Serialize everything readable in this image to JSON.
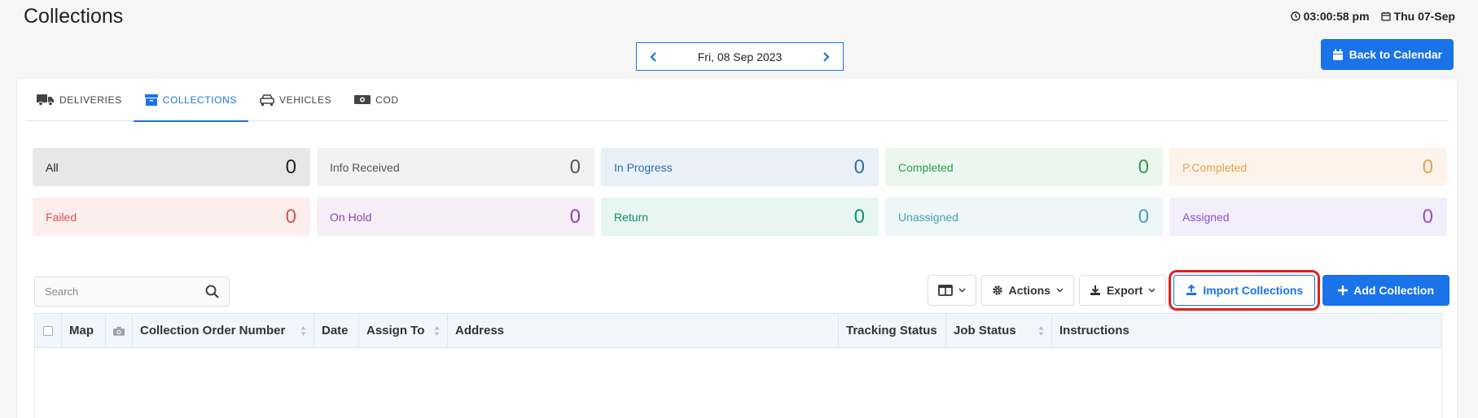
{
  "header": {
    "title": "Collections",
    "time": "03:00:58 pm",
    "date": "Thu 07-Sep"
  },
  "date_nav": {
    "label": "Fri, 08 Sep 2023"
  },
  "back_button": {
    "label": "Back to Calendar"
  },
  "tabs": [
    {
      "label": "DELIVERIES",
      "icon": "truck-icon"
    },
    {
      "label": "COLLECTIONS",
      "icon": "archive-icon",
      "active": true
    },
    {
      "label": "VEHICLES",
      "icon": "car-icon"
    },
    {
      "label": "COD",
      "icon": "money-icon"
    }
  ],
  "stats": [
    {
      "label": "All",
      "count": "0",
      "bg": "#e7e7e7",
      "color": "#222"
    },
    {
      "label": "Info Received",
      "count": "0",
      "bg": "#f2f2f2",
      "color": "#555"
    },
    {
      "label": "In Progress",
      "count": "0",
      "bg": "#eaf0f8",
      "color": "#2e6fa8"
    },
    {
      "label": "Completed",
      "count": "0",
      "bg": "#ebf7ee",
      "color": "#2e9a4b"
    },
    {
      "label": "P.Completed",
      "count": "0",
      "bg": "#fdf3ea",
      "color": "#e7a04d"
    },
    {
      "label": "Failed",
      "count": "0",
      "bg": "#fdeeee",
      "color": "#d9534f"
    },
    {
      "label": "On Hold",
      "count": "0",
      "bg": "#f6eff8",
      "color": "#8e44ad"
    },
    {
      "label": "Return",
      "count": "0",
      "bg": "#e8f6f2",
      "color": "#148a6c"
    },
    {
      "label": "Unassigned",
      "count": "0",
      "bg": "#eef6f8",
      "color": "#4a9fb5"
    },
    {
      "label": "Assigned",
      "count": "0",
      "bg": "#f3eefb",
      "color": "#8c52c9"
    }
  ],
  "search": {
    "placeholder": "Search"
  },
  "toolbar": {
    "actions_label": "Actions",
    "export_label": "Export",
    "import_label": "Import Collections",
    "add_label": "Add Collection"
  },
  "table": {
    "columns": [
      {
        "label": "Map",
        "sortable": false,
        "width": 54
      },
      {
        "label": "",
        "icon": "camera-icon",
        "sortable": false,
        "width": 33
      },
      {
        "label": "Collection Order Number",
        "sortable": true,
        "width": 223
      },
      {
        "label": "Date",
        "sortable": false,
        "width": 55
      },
      {
        "label": "Assign To",
        "sortable": true,
        "width": 109
      },
      {
        "label": "Address",
        "sortable": false,
        "width": 480
      },
      {
        "label": "Tracking Status",
        "sortable": false,
        "width": 132
      },
      {
        "label": "Job Status",
        "sortable": true,
        "width": 130
      },
      {
        "label": "Instructions",
        "sortable": false,
        "width": 480
      }
    ]
  },
  "colors": {
    "accent": "#1a73e8",
    "highlight": "#e02020"
  }
}
